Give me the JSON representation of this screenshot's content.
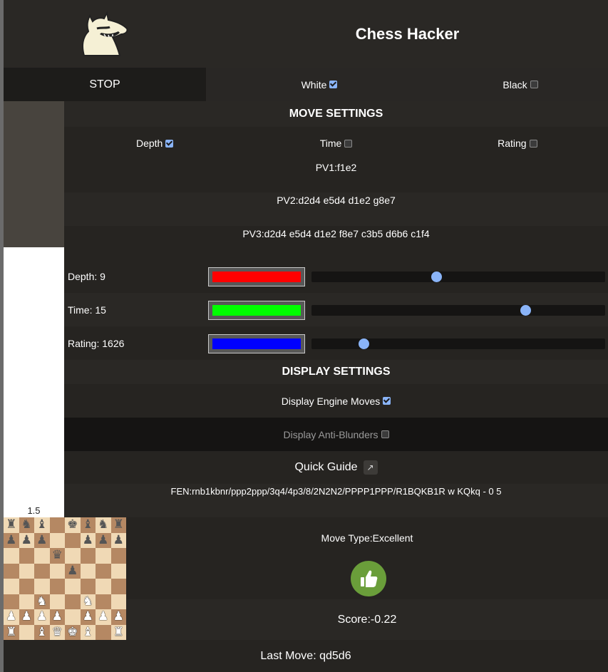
{
  "app": {
    "title": "Chess Hacker"
  },
  "controls": {
    "stop_label": "STOP",
    "white_label": "White",
    "white_checked": true,
    "black_label": "Black",
    "black_checked": false
  },
  "move_settings": {
    "heading": "MOVE SETTINGS",
    "modes": [
      {
        "label": "Depth",
        "checked": true
      },
      {
        "label": "Time",
        "checked": false
      },
      {
        "label": "Rating",
        "checked": false
      }
    ],
    "pv": [
      "PV1:f1e2",
      "PV2:d2d4 e5d4 d1e2 g8e7",
      "PV3:d2d4 e5d4 d1e2 f8e7 c3b5 d6b6 c1f4"
    ]
  },
  "sliders": [
    {
      "label": "Depth: 9",
      "color": "#ff0000",
      "fraction": 0.425
    },
    {
      "label": "Time: 15",
      "color": "#00ff00",
      "fraction": 0.728
    },
    {
      "label": "Rating: 1626",
      "color": "#0000ff",
      "fraction": 0.178
    }
  ],
  "display_settings": {
    "heading": "DISPLAY SETTINGS",
    "engine_moves_label": "Display Engine Moves",
    "engine_moves_checked": true,
    "anti_blunders_label": "Display Anti-Blunders",
    "anti_blunders_checked": false
  },
  "guide": {
    "label": "Quick Guide",
    "icon": "external-link-icon",
    "glyph": "↗"
  },
  "fen": "FEN:rnb1kbnr/ppp2ppp/3q4/4p3/8/2N2N2/PPPP1PPP/R1BQKB1R w KQkq - 0 5",
  "eval": {
    "value": "1.5",
    "white_fraction": 0.649
  },
  "board": {
    "rows": [
      "rnb1kbnr",
      "ppp2ppp",
      "...q....",
      "....p...",
      "........",
      "..N..N..",
      "PPPP1PPP",
      "R.BQKB.R"
    ]
  },
  "analysis": {
    "move_type": "Move Type:Excellent",
    "icon": "thumbs-up-icon",
    "score": "Score:-0.22",
    "last_move": "Last Move: qd5d6"
  },
  "colors": {
    "bg": "#272522",
    "accent": "#8ab4f8",
    "good": "#6a9e3a"
  }
}
